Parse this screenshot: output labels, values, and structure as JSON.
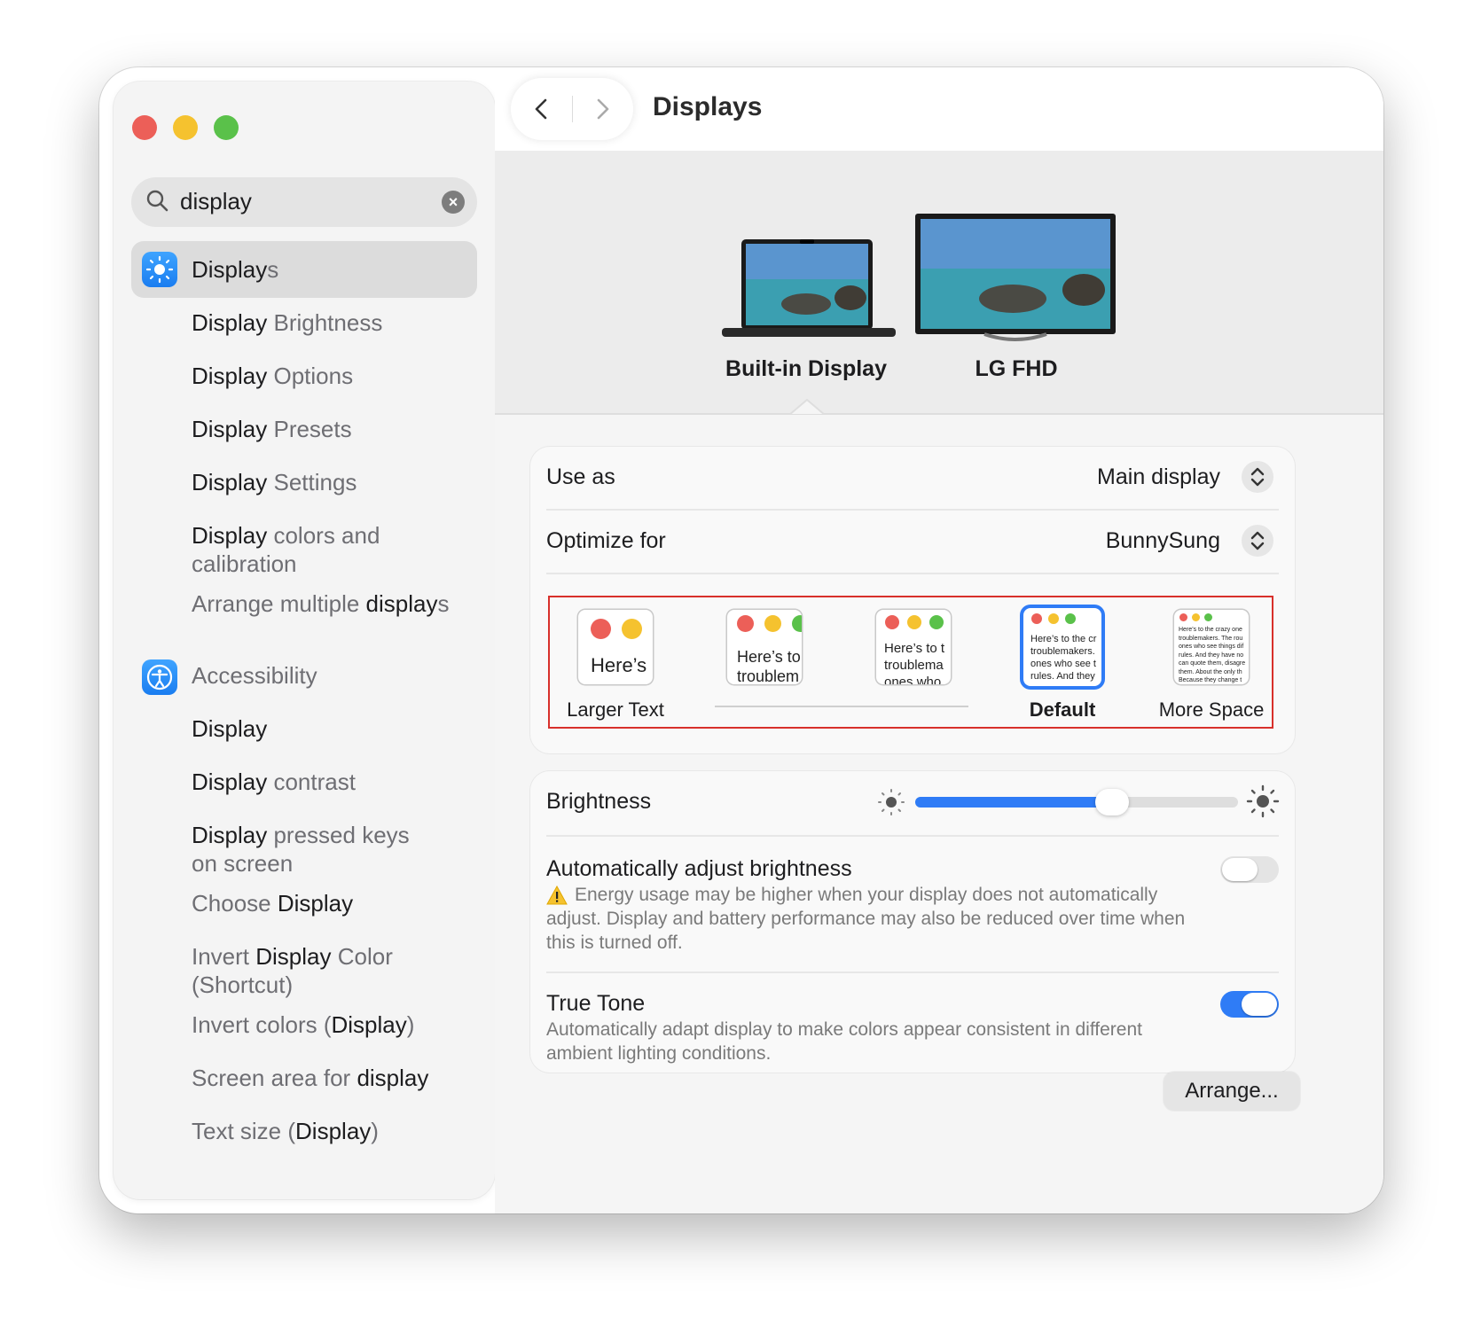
{
  "window": {
    "title": "Displays"
  },
  "search": {
    "value": "display"
  },
  "sidebar": {
    "results": [
      {
        "pre": "",
        "hl": "Display",
        "post": "s"
      },
      {
        "pre": "",
        "hl": "Display",
        "post": " Brightness"
      },
      {
        "pre": "",
        "hl": "Display",
        "post": " Options"
      },
      {
        "pre": "",
        "hl": "Display",
        "post": " Presets"
      },
      {
        "pre": "",
        "hl": "Display",
        "post": " Settings"
      },
      {
        "pre": "",
        "hl": "Display",
        "post": " colors and",
        "line2": "calibration"
      },
      {
        "pre": "Arrange multiple ",
        "hl": "display",
        "post": "s"
      }
    ],
    "accessibility": {
      "label": "Accessibility"
    },
    "acc_results": [
      {
        "pre": "",
        "hl": "Display",
        "post": ""
      },
      {
        "pre": "",
        "hl": "Display",
        "post": " contrast"
      },
      {
        "pre": "",
        "hl": "Display",
        "post": " pressed keys",
        "line2": "on screen"
      },
      {
        "pre": "Choose ",
        "hl": "Display",
        "post": ""
      },
      {
        "pre": "Invert ",
        "hl": "Display",
        "post": " Color",
        "line2": "(Shortcut)"
      },
      {
        "pre": "Invert colors (",
        "hl": "Display",
        "post": ")"
      },
      {
        "pre": "Screen area for ",
        "hl": "display",
        "post": ""
      },
      {
        "pre": "Text size (",
        "hl": "Display",
        "post": ")"
      }
    ]
  },
  "displays": {
    "builtin": "Built-in Display",
    "external": "LG FHD"
  },
  "settings": {
    "use_as": {
      "label": "Use as",
      "value": "Main display"
    },
    "optimize": {
      "label": "Optimize for",
      "value": "BunnySung"
    },
    "resolution": {
      "labels": {
        "larger": "Larger Text",
        "default": "Default",
        "more": "More Space"
      },
      "sample": [
        "Here’s",
        "Here’s to",
        "troublem",
        "Here’s to t",
        "troublema",
        "ones who",
        "Here’s to the cr",
        "troublemakers.",
        "ones who see t",
        "rules. And they",
        "Here’s to the crazy one",
        "troublemakers. The rou",
        "ones who see things dif",
        "rules. And they have no",
        "can quote them, disagre",
        "them. About the only th",
        "Because they change t"
      ],
      "selected_index": 3
    },
    "brightness": {
      "label": "Brightness",
      "level": 0.61
    },
    "auto_brightness": {
      "label": "Automatically adjust brightness",
      "enabled": false,
      "warning": "Energy usage may be higher when your display does not automatically adjust. Display and battery performance may also be reduced over time when this is turned off."
    },
    "true_tone": {
      "label": "True Tone",
      "enabled": true,
      "desc": "Automatically adapt display to make colors appear consistent in different ambient lighting conditions."
    },
    "arrange_button": "Arrange..."
  },
  "colors": {
    "accent": "#2f7cf6",
    "selection_outline": "#d8302b"
  }
}
